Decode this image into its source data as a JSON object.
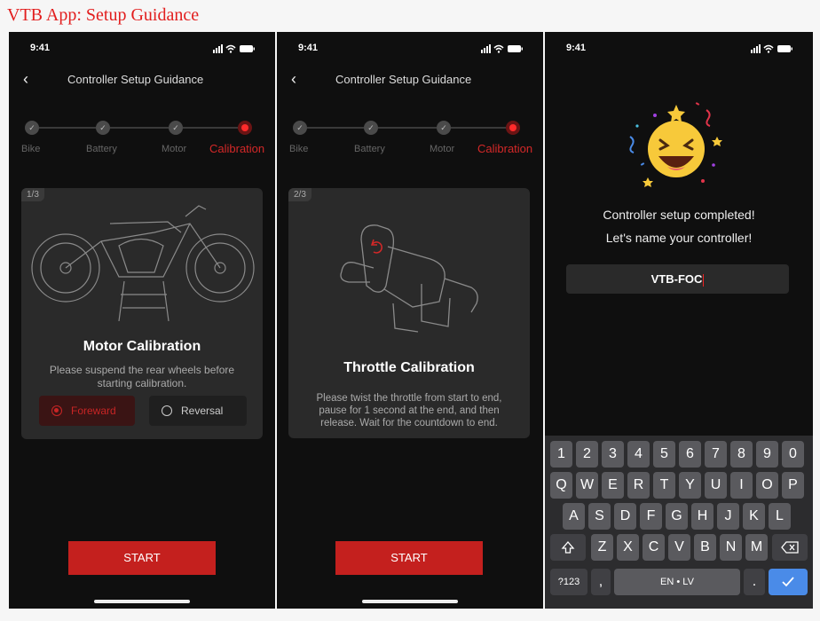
{
  "page": {
    "heading": "VTB App: Setup Guidance"
  },
  "status_bar": {
    "time": "9:41"
  },
  "screens": [
    {
      "nav_title": "Controller Setup Guidance",
      "steps": [
        "Bike",
        "Battery",
        "Motor",
        "Calibration"
      ],
      "active_step": 3,
      "card": {
        "tag": "1/3",
        "title": "Motor Calibration",
        "description": "Please suspend the rear wheels before starting calibration.",
        "options": [
          {
            "label": "Foreward",
            "selected": true
          },
          {
            "label": "Reversal",
            "selected": false
          }
        ]
      },
      "start_label": "START"
    },
    {
      "nav_title": "Controller Setup Guidance",
      "steps": [
        "Bike",
        "Battery",
        "Motor",
        "Calibration"
      ],
      "active_step": 3,
      "card": {
        "tag": "2/3",
        "title": "Throttle Calibration",
        "description": "Please twist the throttle from start to end, pause for 1 second at the end, and then release. Wait for the countdown to end."
      },
      "start_label": "START"
    },
    {
      "completion_line1": "Controller setup completed!",
      "completion_line2": "Let's name your controller!",
      "name_value": "VTB-FOC",
      "keyboard": {
        "row_numbers": [
          "1",
          "2",
          "3",
          "4",
          "5",
          "6",
          "7",
          "8",
          "9",
          "0"
        ],
        "row_top": [
          "Q",
          "W",
          "E",
          "R",
          "T",
          "Y",
          "U",
          "I",
          "O",
          "P"
        ],
        "row_mid": [
          "A",
          "S",
          "D",
          "F",
          "G",
          "H",
          "J",
          "K",
          "L"
        ],
        "row_bottom": [
          "Z",
          "X",
          "C",
          "V",
          "B",
          "N",
          "M"
        ],
        "symbols_key": "?123",
        "comma_key": ",",
        "space_key": "EN • LV",
        "period_key": ".",
        "shift_icon": "shift-icon",
        "backspace_icon": "backspace-icon",
        "done_icon": "checkmark-icon"
      }
    }
  ],
  "colors": {
    "accent": "#c4201e",
    "active_step": "#ff2b2b",
    "background": "#0f0f0f",
    "card": "#2a2a2a",
    "heading": "#e21e1e"
  }
}
